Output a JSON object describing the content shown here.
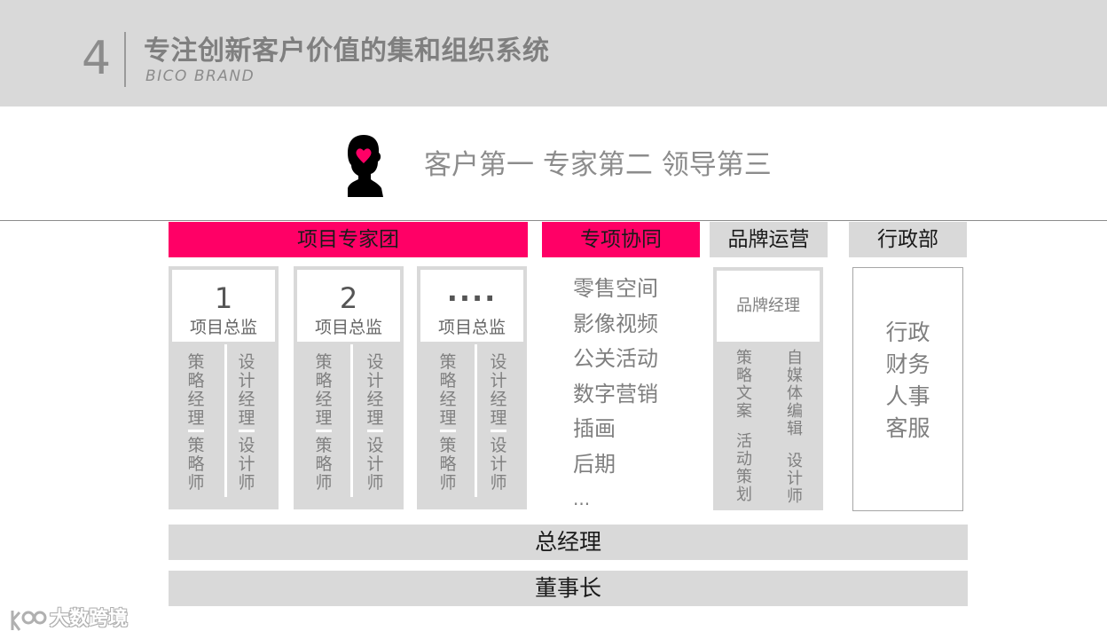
{
  "header": {
    "section_number": "4",
    "title": "专注创新客户价值的集和组织系统",
    "subtitle": "BICO BRAND"
  },
  "slogan": "客户第一 专家第二 领导第三",
  "departments": {
    "expert_team": "项目专家团",
    "special": "专项协同",
    "brand": "品牌运营",
    "admin": "行政部"
  },
  "projects": [
    {
      "number": "1",
      "label": "项目总监",
      "col_a_top": "策略经理",
      "col_a_bottom": "策略师",
      "col_b_top": "设计经理",
      "col_b_bottom": "设计师"
    },
    {
      "number": "2",
      "label": "项目总监",
      "col_a_top": "策略经理",
      "col_a_bottom": "策略师",
      "col_b_top": "设计经理",
      "col_b_bottom": "设计师"
    },
    {
      "number": "····",
      "label": "项目总监",
      "col_a_top": "策略经理",
      "col_a_bottom": "策略师",
      "col_b_top": "设计经理",
      "col_b_bottom": "设计师"
    }
  ],
  "special_items": [
    "零售空间",
    "影像视频",
    "公关活动",
    "数字营销",
    "插画",
    "后期",
    "..."
  ],
  "brand": {
    "manager": "品牌经理",
    "left_top": "策略文案",
    "left_bottom": "活动策划",
    "right_top": "自媒体编辑",
    "right_bottom": "设计师"
  },
  "admin_items": [
    "行政",
    "财务",
    "人事",
    "客服"
  ],
  "general_manager": "总经理",
  "chairman": "董事长",
  "watermark": "大数跨境",
  "colors": {
    "accent": "#ff0066",
    "panel": "#d9d9d9",
    "text_grey": "#7f7f7f"
  }
}
